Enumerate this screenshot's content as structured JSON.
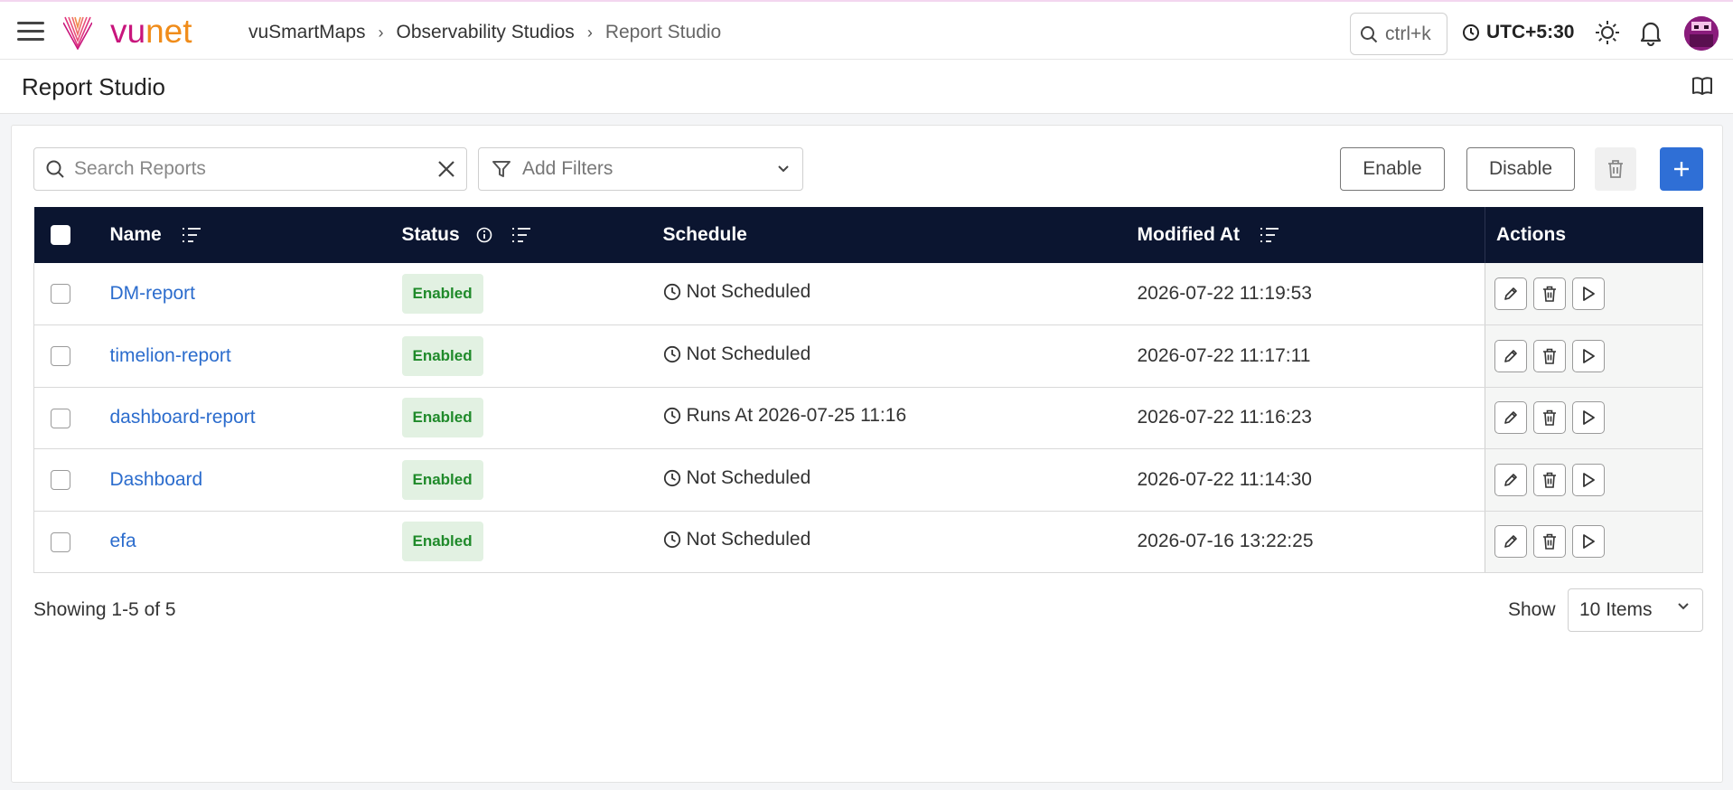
{
  "header": {
    "logo_vu": "vu",
    "logo_net": "net",
    "breadcrumb": [
      "vuSmartMaps",
      "Observability Studios",
      "Report Studio"
    ],
    "search_shortcut": "ctrl+k",
    "timezone": "UTC+5:30",
    "brand_colors": {
      "vu": "#c8157c",
      "net": "#f08c1a"
    }
  },
  "page": {
    "title": "Report Studio"
  },
  "toolbar": {
    "search_placeholder": "Search Reports",
    "filter_label": "Add Filters",
    "enable_label": "Enable",
    "disable_label": "Disable",
    "add_color": "#2f6fd6"
  },
  "table": {
    "headers": {
      "name": "Name",
      "status": "Status",
      "schedule": "Schedule",
      "modified": "Modified At",
      "actions": "Actions"
    },
    "rows": [
      {
        "name": "DM-report",
        "status": "Enabled",
        "schedule": "Not Scheduled",
        "modified": "2026-07-22 11:19:53"
      },
      {
        "name": "timelion-report",
        "status": "Enabled",
        "schedule": "Not Scheduled",
        "modified": "2026-07-22 11:17:11"
      },
      {
        "name": "dashboard-report",
        "status": "Enabled",
        "schedule": "Runs At 2026-07-25 11:16",
        "modified": "2026-07-22 11:16:23"
      },
      {
        "name": "Dashboard",
        "status": "Enabled",
        "schedule": "Not Scheduled",
        "modified": "2026-07-22 11:14:30"
      },
      {
        "name": "efa",
        "status": "Enabled",
        "schedule": "Not Scheduled",
        "modified": "2026-07-16 13:22:25"
      }
    ]
  },
  "pagination": {
    "summary": "Showing 1-5 of 5",
    "show_label": "Show",
    "page_size": "10 Items"
  }
}
